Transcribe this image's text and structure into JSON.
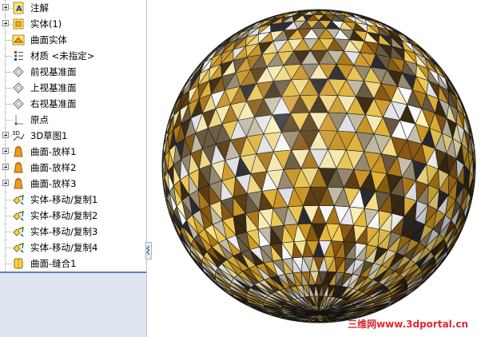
{
  "feature_tree": {
    "items": [
      {
        "label": "注解",
        "icon": "annotations-icon",
        "expand": true
      },
      {
        "label": "实体(1)",
        "icon": "solid-bodies-icon",
        "expand": true
      },
      {
        "label": "曲面实体",
        "icon": "surface-bodies-icon",
        "expand": false
      },
      {
        "label": "材质 <未指定>",
        "icon": "material-icon",
        "expand": false
      },
      {
        "label": "前视基准面",
        "icon": "plane-icon",
        "expand": false
      },
      {
        "label": "上视基准面",
        "icon": "plane-icon",
        "expand": false
      },
      {
        "label": "右视基准面",
        "icon": "plane-icon",
        "expand": false
      },
      {
        "label": "原点",
        "icon": "origin-icon",
        "expand": false
      },
      {
        "label": "3D草图1",
        "icon": "sketch3d-icon",
        "expand": true
      },
      {
        "label": "曲面-放样1",
        "icon": "surface-loft-icon",
        "expand": true
      },
      {
        "label": "曲面-放样2",
        "icon": "surface-loft-icon",
        "expand": true
      },
      {
        "label": "曲面-放样3",
        "icon": "surface-loft-icon",
        "expand": true
      },
      {
        "label": "实体-移动/复制1",
        "icon": "move-copy-icon",
        "expand": false
      },
      {
        "label": "实体-移动/复制2",
        "icon": "move-copy-icon",
        "expand": false
      },
      {
        "label": "实体-移动/复制3",
        "icon": "move-copy-icon",
        "expand": false
      },
      {
        "label": "实体-移动/复制4",
        "icon": "move-copy-icon",
        "expand": false
      },
      {
        "label": "曲面-缝合1",
        "icon": "surface-knit-icon",
        "expand": false
      }
    ]
  },
  "viewport": {
    "model": "faceted-sphere",
    "palette": [
      "#3a2a12",
      "#5c3d12",
      "#8a5a14",
      "#b07a1a",
      "#d09a24",
      "#e8b83a",
      "#f2cc55",
      "#f8e08a",
      "#fff2b8",
      "#ffffff",
      "#c8c0a8",
      "#9a8c70",
      "#6a5a40",
      "#2a2a30",
      "#eaeaf0",
      "#d8a030"
    ]
  },
  "watermark": {
    "cn": "三维网",
    "url": "www.3dportal.cn"
  }
}
